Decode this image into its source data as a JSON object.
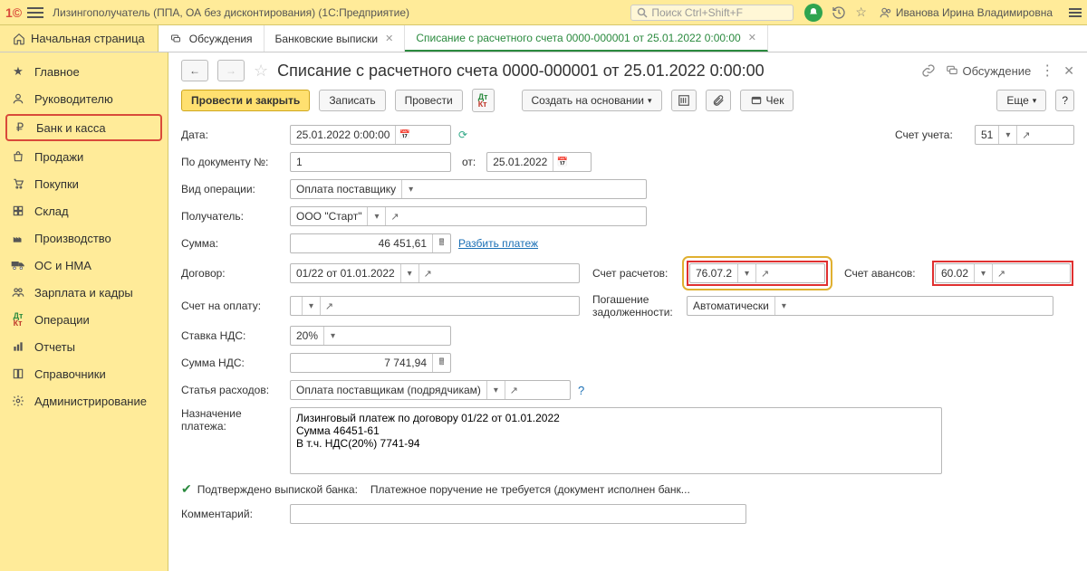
{
  "top": {
    "title": "Лизингополучатель (ППА, ОА без дисконтирования)  (1С:Предприятие)",
    "search_placeholder": "Поиск Ctrl+Shift+F",
    "user": "Иванова Ирина Владимировна"
  },
  "tabs": {
    "home": "Начальная страница",
    "t1": "Обсуждения",
    "t2": "Банковские выписки",
    "t3": "Списание с расчетного счета 0000-000001 от 25.01.2022 0:00:00"
  },
  "sidebar": {
    "items": [
      "Главное",
      "Руководителю",
      "Банк и касса",
      "Продажи",
      "Покупки",
      "Склад",
      "Производство",
      "ОС и НМА",
      "Зарплата и кадры",
      "Операции",
      "Отчеты",
      "Справочники",
      "Администрирование"
    ]
  },
  "doc": {
    "title": "Списание с расчетного счета 0000-000001 от 25.01.2022 0:00:00",
    "discuss": "Обсуждение"
  },
  "toolbar": {
    "post_close": "Провести и закрыть",
    "write": "Записать",
    "post": "Провести",
    "create_based": "Создать на основании",
    "check": "Чек",
    "more": "Еще",
    "qmark": "?"
  },
  "labels": {
    "date": "Дата:",
    "account": "Счет учета:",
    "doc_no": "По документу №:",
    "doc_from": "от:",
    "op_type": "Вид операции:",
    "recipient": "Получатель:",
    "sum": "Сумма:",
    "split": "Разбить платеж",
    "contract": "Договор:",
    "settle_acc": "Счет расчетов:",
    "advance_acc": "Счет авансов:",
    "pay_invoice": "Счет на оплату:",
    "debt_line1": "Погашение",
    "debt_line2": "задолженности:",
    "vat_rate": "Ставка НДС:",
    "vat_sum": "Сумма НДС:",
    "expense": "Статья расходов:",
    "purpose_line1": "Назначение",
    "purpose_line2": "платежа:",
    "confirmed": "Подтверждено выпиской банка:",
    "confirmed_text": "Платежное поручение не требуется (документ исполнен банк...",
    "comment": "Комментарий:"
  },
  "values": {
    "date": "25.01.2022  0:00:00",
    "account": "51",
    "doc_no": "1",
    "doc_date": "25.01.2022",
    "op_type": "Оплата поставщику",
    "recipient": "ООО \"Старт\"",
    "sum": "46 451,61",
    "contract": "01/22 от 01.01.2022",
    "settle_acc": "76.07.2",
    "advance_acc": "60.02",
    "debt": "Автоматически",
    "vat_rate": "20%",
    "vat_sum": "7 741,94",
    "expense": "Оплата поставщикам (подрядчикам)",
    "purpose": "Лизинговый платеж по договору 01/22 от 01.01.2022\nСумма 46451-61\nВ т.ч. НДС(20%) 7741-94"
  }
}
